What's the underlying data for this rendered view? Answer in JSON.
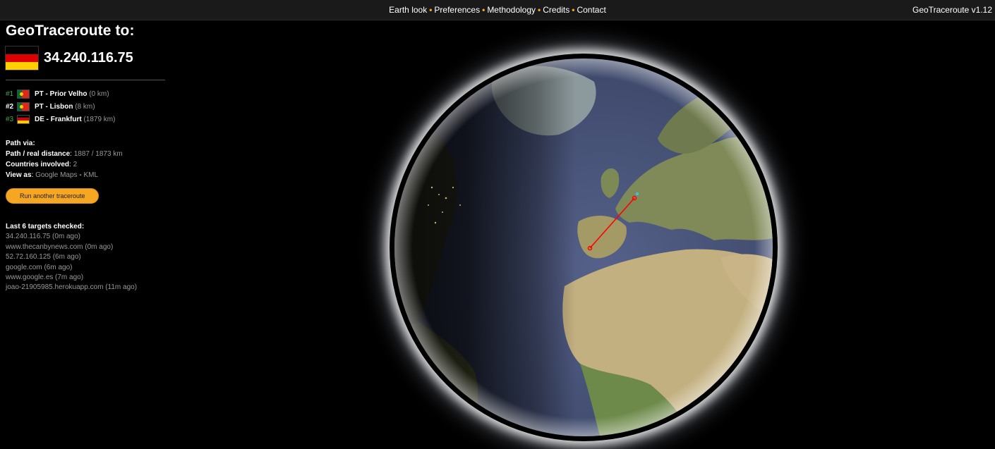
{
  "nav": {
    "items": [
      "Earth look",
      "Preferences",
      "Methodology",
      "Credits",
      "Contact"
    ],
    "version": "GeoTraceroute v1.12"
  },
  "panel": {
    "title": "GeoTraceroute to:",
    "target_ip": "34.240.116.75",
    "target_flag": "flag-de-icon",
    "hops": [
      {
        "num": "#1",
        "country": "PT",
        "location": "PT - Prior Velho",
        "distance": "(0 km)",
        "flag": "flag-pt-icon"
      },
      {
        "num": "#2",
        "country": "PT",
        "location": "PT - Lisbon",
        "distance": "(8 km)",
        "flag": "flag-pt-icon"
      },
      {
        "num": "#3",
        "country": "DE",
        "location": "DE - Frankfurt",
        "distance": "(1879 km)",
        "flag": "flag-de-icon"
      }
    ],
    "path_via_label": "Path via:",
    "distance_label": "Path / real distance",
    "distance_value": " 1887 / 1873 km",
    "countries_label": "Countries involved",
    "countries_value": " 2",
    "view_label": "View as",
    "view_google": "Google Maps",
    "view_sep": " - ",
    "view_kml": "KML",
    "button_label": "Run another traceroute",
    "recent_title": "Last 6 targets checked:",
    "recent": [
      "34.240.116.75 (0m ago)",
      "www.thecanbynews.com (0m ago)",
      "52.72.160.125 (6m ago)",
      "google.com (6m ago)",
      "www.google.es (7m ago)",
      "joao-21905985.herokuapp.com (11m ago)"
    ]
  },
  "colors": {
    "accent": "#f5a623",
    "hop_green": "#3cb043",
    "route_line": "#ff0000",
    "ocean": "#3f4a6b",
    "land": "#9c9a6a"
  }
}
